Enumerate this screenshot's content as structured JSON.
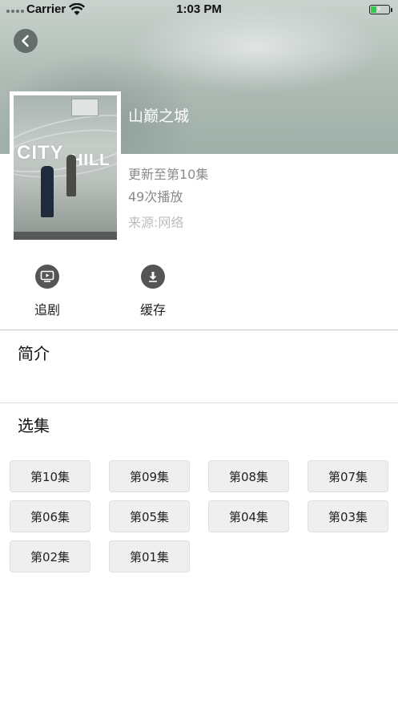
{
  "status_bar": {
    "carrier": "Carrier",
    "time": "1:03 PM",
    "battery_color": "#35c84a",
    "battery_level": 0.35
  },
  "header": {
    "back_icon": "chevron-left-icon"
  },
  "show": {
    "title": "山巅之城",
    "updated": "更新至第10集",
    "plays": "49次播放",
    "source": "来源:网络",
    "poster_text_city": "CITY",
    "poster_text_hill": "HILL"
  },
  "actions": [
    {
      "label": "追剧",
      "icon": "tv-play-icon"
    },
    {
      "label": "缓存",
      "icon": "download-icon"
    }
  ],
  "sections": {
    "intro_title": "简介",
    "episodes_title": "选集"
  },
  "episodes": [
    "第10集",
    "第09集",
    "第08集",
    "第07集",
    "第06集",
    "第05集",
    "第04集",
    "第03集",
    "第02集",
    "第01集"
  ],
  "colors": {
    "accent_text": "#8a8a8a",
    "button_bg": "#efefef"
  }
}
